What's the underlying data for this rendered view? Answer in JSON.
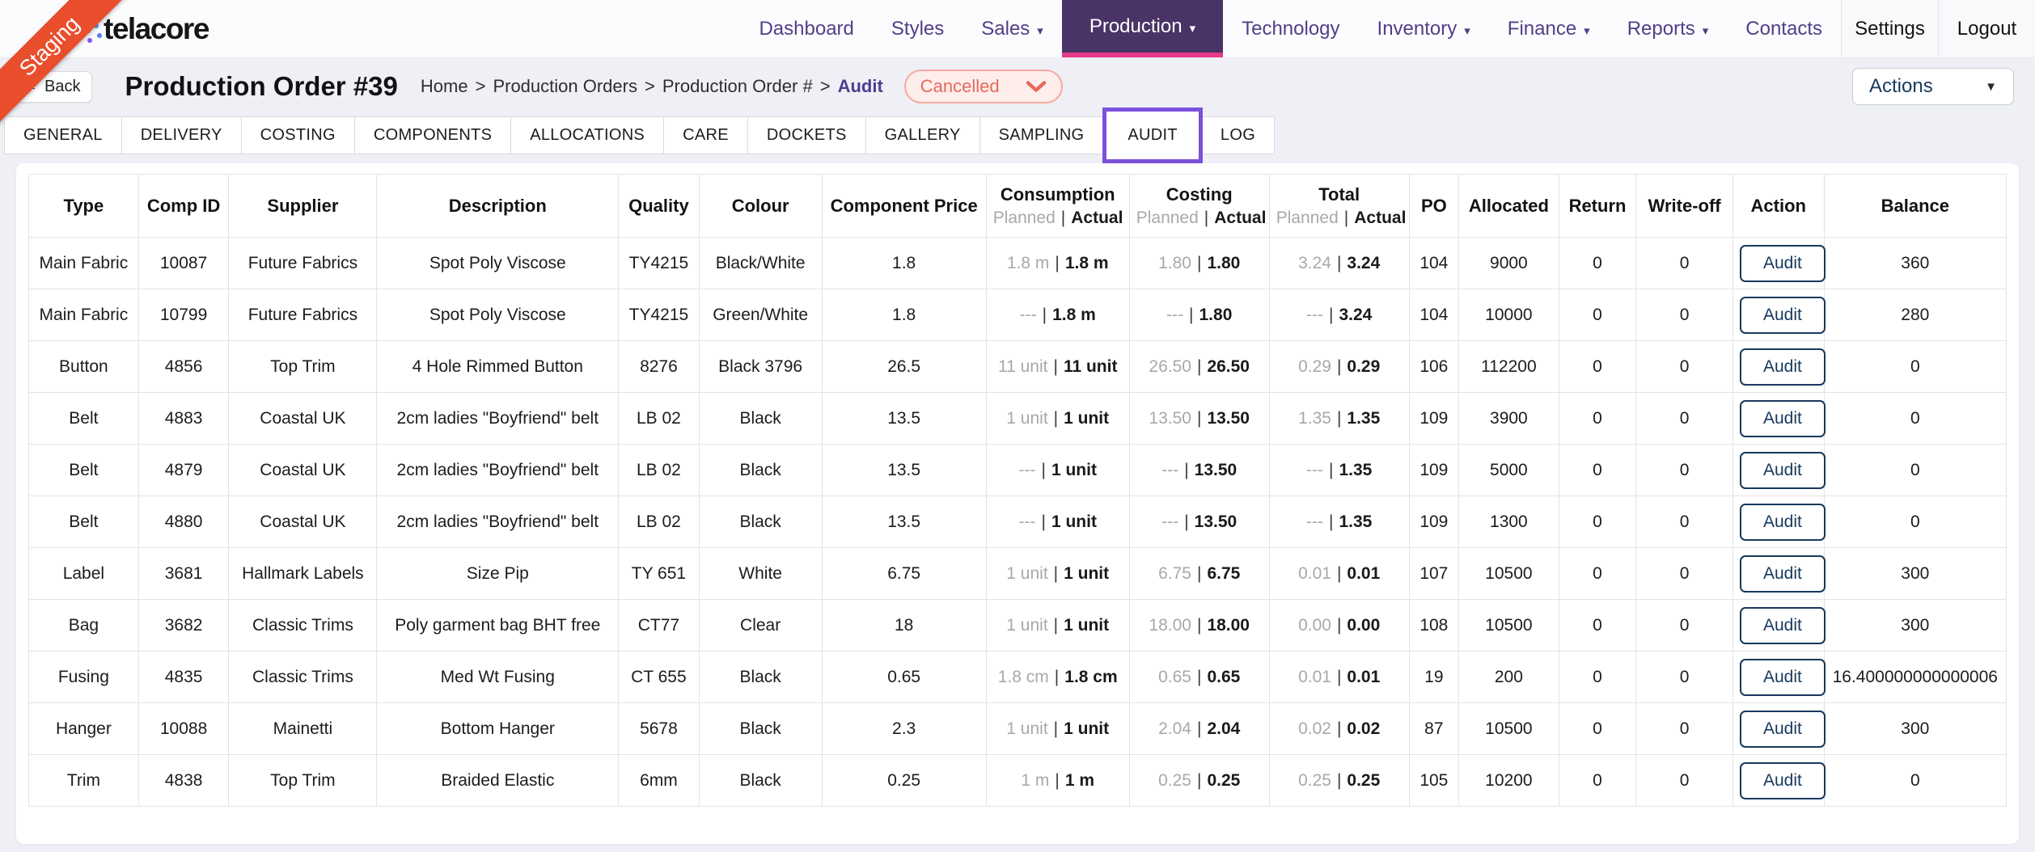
{
  "brand": {
    "logo": "telacore",
    "ribbon": "Staging"
  },
  "nav": {
    "items": [
      {
        "label": "Dashboard",
        "dropdown": false,
        "active": false
      },
      {
        "label": "Styles",
        "dropdown": false,
        "active": false
      },
      {
        "label": "Sales",
        "dropdown": true,
        "active": false
      },
      {
        "label": "Production",
        "dropdown": true,
        "active": true
      },
      {
        "label": "Technology",
        "dropdown": false,
        "active": false
      },
      {
        "label": "Inventory",
        "dropdown": true,
        "active": false
      },
      {
        "label": "Finance",
        "dropdown": true,
        "active": false
      },
      {
        "label": "Reports",
        "dropdown": true,
        "active": false
      },
      {
        "label": "Contacts",
        "dropdown": false,
        "active": false
      }
    ],
    "settings": "Settings",
    "logout": "Logout"
  },
  "page_header": {
    "back_label": "Back",
    "title": "Production Order #39",
    "breadcrumb": {
      "items": [
        "Home",
        "Production Orders",
        "Production Order #"
      ],
      "current": "Audit",
      "separator": ">"
    },
    "status": "Cancelled",
    "actions_label": "Actions"
  },
  "tabs": [
    "GENERAL",
    "DELIVERY",
    "COSTING",
    "COMPONENTS",
    "ALLOCATIONS",
    "CARE",
    "DOCKETS",
    "GALLERY",
    "SAMPLING",
    "AUDIT",
    "LOG"
  ],
  "active_tab": "AUDIT",
  "table": {
    "columns": [
      "Type",
      "Comp ID",
      "Supplier",
      "Description",
      "Quality",
      "Colour",
      "Component Price",
      "Consumption",
      "Costing",
      "Total",
      "PO",
      "Allocated",
      "Return",
      "Write-off",
      "Action",
      "Balance"
    ],
    "subheader": {
      "planned": "Planned",
      "actual": "Actual"
    },
    "action_label": "Audit",
    "rows": [
      {
        "type": "Main Fabric",
        "comp_id": "10087",
        "supplier": "Future Fabrics",
        "description": "Spot Poly Viscose",
        "quality": "TY4215",
        "colour": "Black/White",
        "price": "1.8",
        "cons_planned": "1.8 m",
        "cons_actual": "1.8 m",
        "cost_planned": "1.80",
        "cost_actual": "1.80",
        "total_planned": "3.24",
        "total_actual": "3.24",
        "po": "104",
        "allocated": "9000",
        "return": "0",
        "writeoff": "0",
        "balance": "360"
      },
      {
        "type": "Main Fabric",
        "comp_id": "10799",
        "supplier": "Future Fabrics",
        "description": "Spot Poly Viscose",
        "quality": "TY4215",
        "colour": "Green/White",
        "price": "1.8",
        "cons_planned": "---",
        "cons_actual": "1.8 m",
        "cost_planned": "---",
        "cost_actual": "1.80",
        "total_planned": "---",
        "total_actual": "3.24",
        "po": "104",
        "allocated": "10000",
        "return": "0",
        "writeoff": "0",
        "balance": "280"
      },
      {
        "type": "Button",
        "comp_id": "4856",
        "supplier": "Top Trim",
        "description": "4 Hole Rimmed Button",
        "quality": "8276",
        "colour": "Black 3796",
        "price": "26.5",
        "cons_planned": "11 unit",
        "cons_actual": "11 unit",
        "cost_planned": "26.50",
        "cost_actual": "26.50",
        "total_planned": "0.29",
        "total_actual": "0.29",
        "po": "106",
        "allocated": "112200",
        "return": "0",
        "writeoff": "0",
        "balance": "0"
      },
      {
        "type": "Belt",
        "comp_id": "4883",
        "supplier": "Coastal UK",
        "description": "2cm ladies \"Boyfriend\" belt",
        "quality": "LB 02",
        "colour": "Black",
        "price": "13.5",
        "cons_planned": "1 unit",
        "cons_actual": "1 unit",
        "cost_planned": "13.50",
        "cost_actual": "13.50",
        "total_planned": "1.35",
        "total_actual": "1.35",
        "po": "109",
        "allocated": "3900",
        "return": "0",
        "writeoff": "0",
        "balance": "0"
      },
      {
        "type": "Belt",
        "comp_id": "4879",
        "supplier": "Coastal UK",
        "description": "2cm ladies \"Boyfriend\" belt",
        "quality": "LB 02",
        "colour": "Black",
        "price": "13.5",
        "cons_planned": "---",
        "cons_actual": "1 unit",
        "cost_planned": "---",
        "cost_actual": "13.50",
        "total_planned": "---",
        "total_actual": "1.35",
        "po": "109",
        "allocated": "5000",
        "return": "0",
        "writeoff": "0",
        "balance": "0"
      },
      {
        "type": "Belt",
        "comp_id": "4880",
        "supplier": "Coastal UK",
        "description": "2cm ladies \"Boyfriend\" belt",
        "quality": "LB 02",
        "colour": "Black",
        "price": "13.5",
        "cons_planned": "---",
        "cons_actual": "1 unit",
        "cost_planned": "---",
        "cost_actual": "13.50",
        "total_planned": "---",
        "total_actual": "1.35",
        "po": "109",
        "allocated": "1300",
        "return": "0",
        "writeoff": "0",
        "balance": "0"
      },
      {
        "type": "Label",
        "comp_id": "3681",
        "supplier": "Hallmark Labels",
        "description": "Size Pip",
        "quality": "TY 651",
        "colour": "White",
        "price": "6.75",
        "cons_planned": "1 unit",
        "cons_actual": "1 unit",
        "cost_planned": "6.75",
        "cost_actual": "6.75",
        "total_planned": "0.01",
        "total_actual": "0.01",
        "po": "107",
        "allocated": "10500",
        "return": "0",
        "writeoff": "0",
        "balance": "300"
      },
      {
        "type": "Bag",
        "comp_id": "3682",
        "supplier": "Classic Trims",
        "description": "Poly garment bag BHT free",
        "quality": "CT77",
        "colour": "Clear",
        "price": "18",
        "cons_planned": "1 unit",
        "cons_actual": "1 unit",
        "cost_planned": "18.00",
        "cost_actual": "18.00",
        "total_planned": "0.00",
        "total_actual": "0.00",
        "po": "108",
        "allocated": "10500",
        "return": "0",
        "writeoff": "0",
        "balance": "300"
      },
      {
        "type": "Fusing",
        "comp_id": "4835",
        "supplier": "Classic Trims",
        "description": "Med Wt Fusing",
        "quality": "CT 655",
        "colour": "Black",
        "price": "0.65",
        "cons_planned": "1.8 cm",
        "cons_actual": "1.8 cm",
        "cost_planned": "0.65",
        "cost_actual": "0.65",
        "total_planned": "0.01",
        "total_actual": "0.01",
        "po": "19",
        "allocated": "200",
        "return": "0",
        "writeoff": "0",
        "balance": "16.400000000000006"
      },
      {
        "type": "Hanger",
        "comp_id": "10088",
        "supplier": "Mainetti",
        "description": "Bottom Hanger",
        "quality": "5678",
        "colour": "Black",
        "price": "2.3",
        "cons_planned": "1 unit",
        "cons_actual": "1 unit",
        "cost_planned": "2.04",
        "cost_actual": "2.04",
        "total_planned": "0.02",
        "total_actual": "0.02",
        "po": "87",
        "allocated": "10500",
        "return": "0",
        "writeoff": "0",
        "balance": "300"
      },
      {
        "type": "Trim",
        "comp_id": "4838",
        "supplier": "Top Trim",
        "description": "Braided Elastic",
        "quality": "6mm",
        "colour": "Black",
        "price": "0.25",
        "cons_planned": "1 m",
        "cons_actual": "1 m",
        "cost_planned": "0.25",
        "cost_actual": "0.25",
        "total_planned": "0.25",
        "total_actual": "0.25",
        "po": "105",
        "allocated": "10200",
        "return": "0",
        "writeoff": "0",
        "balance": "0"
      }
    ]
  },
  "colors": {
    "accent_purple": "#4a3366",
    "nav_text": "#513f86",
    "active_underline": "#e7388a",
    "tab_highlight": "#7c50da",
    "ribbon_orange": "#e94e2d",
    "status_text": "#e66a5c",
    "status_bg": "#fdedeb",
    "status_border": "#f5aaa1",
    "button_navy": "#17395d"
  }
}
